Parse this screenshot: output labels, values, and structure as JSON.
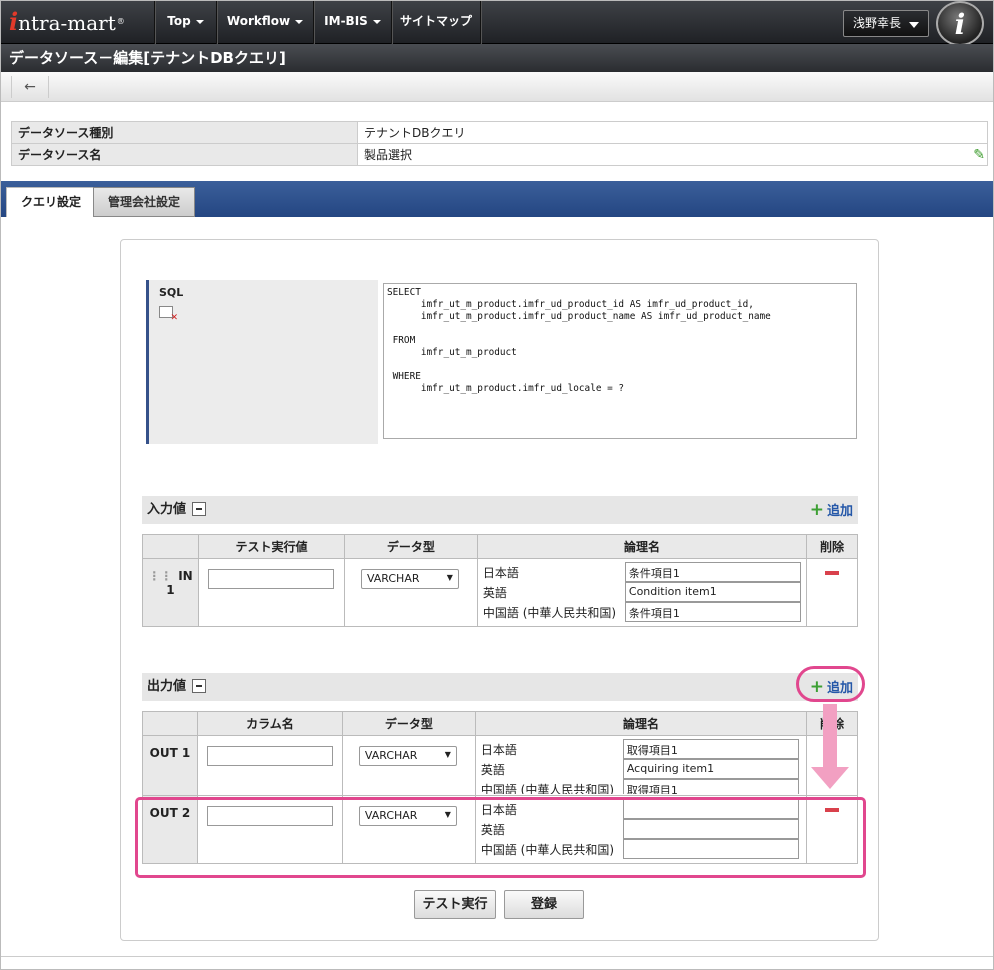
{
  "header": {
    "logo_text": "intra-mart",
    "nav": [
      "Top",
      "Workflow",
      "IM-BIS",
      "サイトマップ"
    ],
    "user_name": "浅野幸長"
  },
  "page": {
    "title": "データソース－編集[テナントDBクエリ]",
    "back_symbol": "←"
  },
  "info": {
    "type_label": "データソース種別",
    "type_value": "テナントDBクエリ",
    "name_label": "データソース名",
    "name_value": "製品選択"
  },
  "tabs": [
    "クエリ設定",
    "管理会社設定"
  ],
  "sql": {
    "label": "SQL",
    "text": "SELECT\n      imfr_ut_m_product.imfr_ud_product_id AS imfr_ud_product_id,\n      imfr_ut_m_product.imfr_ud_product_name AS imfr_ud_product_name\n\n FROM\n      imfr_ut_m_product\n\n WHERE\n      imfr_ut_m_product.imfr_ud_locale = ?"
  },
  "input_section": {
    "title": "入力値",
    "add_label": "追加",
    "columns": [
      "テスト実行値",
      "データ型",
      "論理名",
      "削除"
    ],
    "rows": [
      {
        "id": "IN 1",
        "test_value": "",
        "type": "VARCHAR",
        "ja": "条件項目1",
        "en": "Condition item1",
        "zh": "条件項目1"
      }
    ]
  },
  "output_section": {
    "title": "出力値",
    "add_label": "追加",
    "columns": [
      "カラム名",
      "データ型",
      "論理名",
      "削除"
    ],
    "rows": [
      {
        "id": "OUT 1",
        "column": "",
        "type": "VARCHAR",
        "ja": "取得項目1",
        "en": "Acquiring item1",
        "zh": "取得項目1"
      },
      {
        "id": "OUT 2",
        "column": "",
        "type": "VARCHAR",
        "ja": "",
        "en": "",
        "zh": ""
      }
    ]
  },
  "lang_labels": {
    "ja": "日本語",
    "en": "英語",
    "zh": "中国語 (中華人民共和国)"
  },
  "buttons": {
    "test_run": "テスト実行",
    "register": "登録"
  },
  "colors": {
    "accent_blue": "#2a4b87",
    "highlight_pink": "#e1478e",
    "add_green": "#3da034",
    "delete_red": "#d9414c"
  }
}
